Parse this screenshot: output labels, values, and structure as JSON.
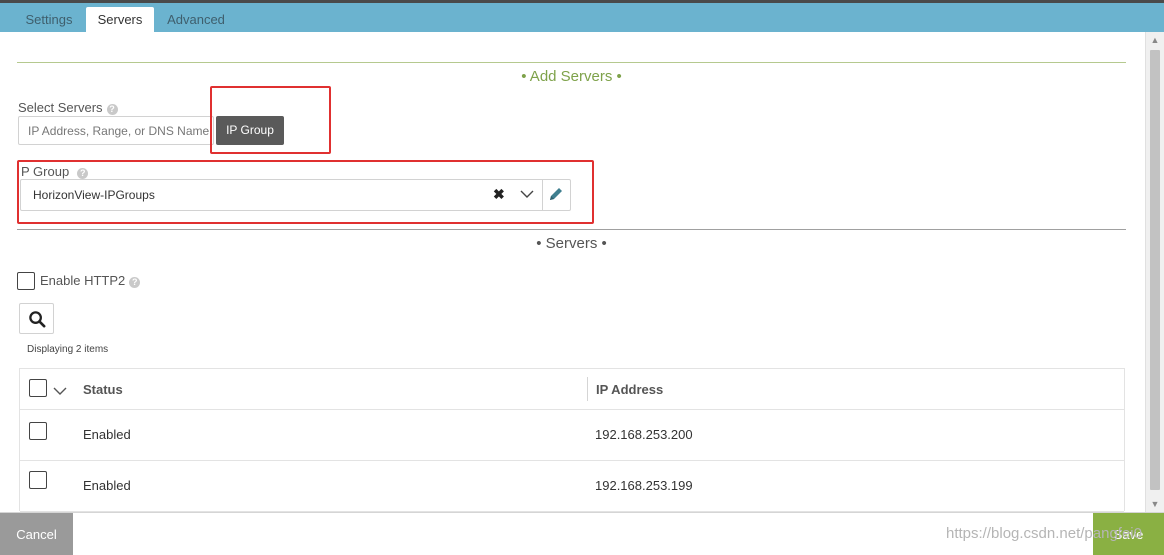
{
  "tabs": [
    {
      "label": "Settings"
    },
    {
      "label": "Servers"
    },
    {
      "label": "Advanced"
    }
  ],
  "add_servers": {
    "section_title": "• Add Servers •",
    "section_color": "#7ea24a",
    "select_servers_label": "Select Servers",
    "server_input_placeholder": "IP Address, Range, or DNS Name",
    "ip_group_button": "IP Group",
    "ip_group_label": "P Group",
    "ip_group_value": "HorizonView-IPGroups"
  },
  "servers": {
    "section_title": "• Servers •",
    "enable_http2_label": "Enable HTTP2",
    "display_count": "Displaying 2 items",
    "columns": {
      "status": "Status",
      "ip_address": "IP Address"
    },
    "rows": [
      {
        "status": "Enabled",
        "ip_address": "192.168.253.200"
      },
      {
        "status": "Enabled",
        "ip_address": "192.168.253.199"
      }
    ]
  },
  "footer": {
    "cancel_label": "Cancel",
    "save_label": "Save",
    "watermark": "https://blog.csdn.net/pangfei0"
  },
  "colors": {
    "tabbar": "#6bb3cf",
    "annotation_red": "#e03030",
    "save_green": "#8ab043",
    "cancel_gray": "#9a9a9a",
    "ip_group_button": "#5a5a5a"
  },
  "icons": {
    "help": "question-circle-icon",
    "clear": "x-icon",
    "dropdown": "chevron-down-icon",
    "edit": "pencil-icon",
    "search": "magnifier-icon"
  }
}
